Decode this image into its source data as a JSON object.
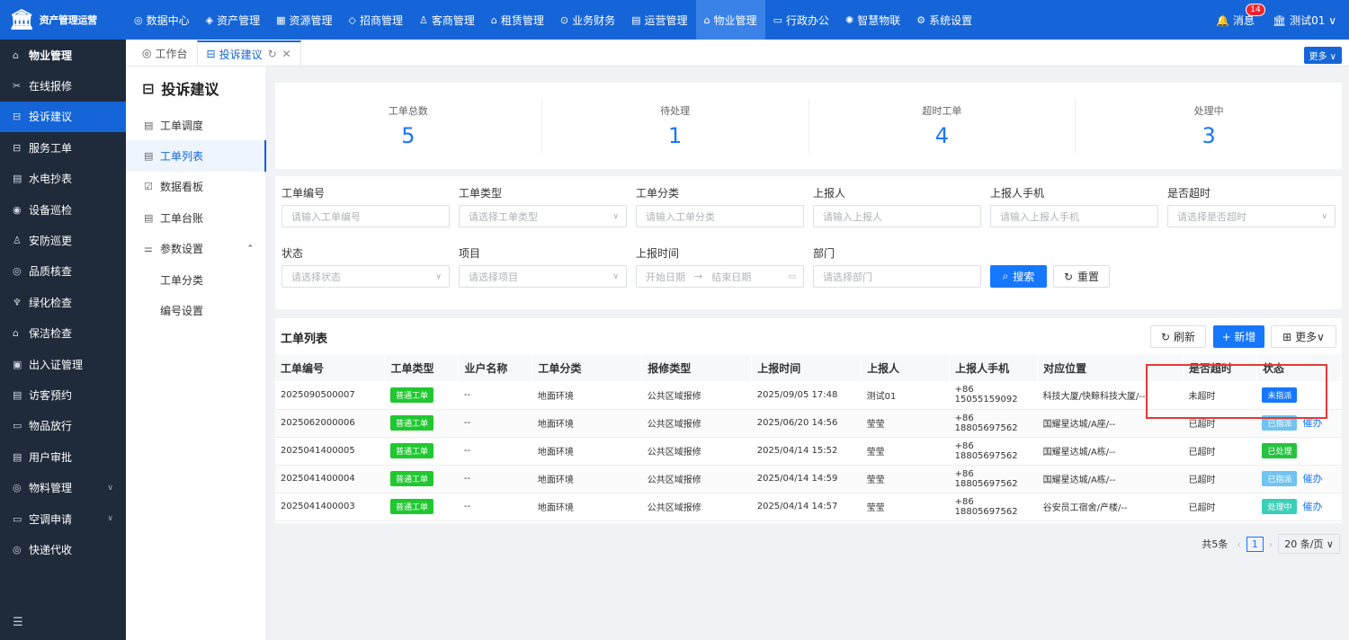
{
  "brand": "资产管理运营",
  "topnav": [
    {
      "label": "数据中心",
      "icon": "dashboard-icon"
    },
    {
      "label": "资产管理",
      "icon": "cube-icon"
    },
    {
      "label": "资源管理",
      "icon": "building-icon"
    },
    {
      "label": "招商管理",
      "icon": "tag-icon"
    },
    {
      "label": "客商管理",
      "icon": "users-icon"
    },
    {
      "label": "租赁管理",
      "icon": "house-icon"
    },
    {
      "label": "业务财务",
      "icon": "coin-icon"
    },
    {
      "label": "运营管理",
      "icon": "chart-icon"
    },
    {
      "label": "物业管理",
      "icon": "home-icon",
      "active": true
    },
    {
      "label": "行政办公",
      "icon": "monitor-icon"
    },
    {
      "label": "智慧物联",
      "icon": "iot-icon"
    },
    {
      "label": "系统设置",
      "icon": "gear-icon"
    }
  ],
  "topright": {
    "msg_label": "消息",
    "msg_count": "14",
    "user": "测试01"
  },
  "sidebar": [
    {
      "label": "物业管理",
      "bold": true
    },
    {
      "label": "在线报修"
    },
    {
      "label": "投诉建议",
      "active": true
    },
    {
      "label": "服务工单"
    },
    {
      "label": "水电抄表"
    },
    {
      "label": "设备巡检"
    },
    {
      "label": "安防巡更"
    },
    {
      "label": "品质核查"
    },
    {
      "label": "绿化检查"
    },
    {
      "label": "保洁检查"
    },
    {
      "label": "出入证管理"
    },
    {
      "label": "访客预约"
    },
    {
      "label": "物品放行"
    },
    {
      "label": "用户审批"
    },
    {
      "label": "物料管理",
      "arrow": true
    },
    {
      "label": "空调申请",
      "arrow": true
    },
    {
      "label": "快递代收"
    }
  ],
  "tabs": {
    "workbench": "工作台",
    "current": "投诉建议",
    "more": "更多"
  },
  "subside": {
    "title": "投诉建议",
    "items": [
      {
        "label": "工单调度"
      },
      {
        "label": "工单列表",
        "active": true
      },
      {
        "label": "数据看板"
      },
      {
        "label": "工单台账"
      },
      {
        "label": "参数设置",
        "arrow": true
      },
      {
        "label": "工单分类",
        "child": true
      },
      {
        "label": "编号设置",
        "child": true
      }
    ]
  },
  "stats": [
    {
      "label": "工单总数",
      "value": "5"
    },
    {
      "label": "待处理",
      "value": "1"
    },
    {
      "label": "超时工单",
      "value": "4"
    },
    {
      "label": "处理中",
      "value": "3"
    }
  ],
  "filter": {
    "f1": {
      "label": "工单编号",
      "placeholder": "请输入工单编号"
    },
    "f2": {
      "label": "工单类型",
      "placeholder": "请选择工单类型"
    },
    "f3": {
      "label": "工单分类",
      "placeholder": "请输入工单分类"
    },
    "f4": {
      "label": "上报人",
      "placeholder": "请输入上报人"
    },
    "f5": {
      "label": "上报人手机",
      "placeholder": "请输入上报人手机"
    },
    "f6": {
      "label": "是否超时",
      "placeholder": "请选择是否超时"
    },
    "f7": {
      "label": "状态",
      "placeholder": "请选择状态"
    },
    "f8": {
      "label": "项目",
      "placeholder": "请选择项目"
    },
    "f9": {
      "label": "上报时间",
      "start": "开始日期",
      "end": "结束日期"
    },
    "f10": {
      "label": "部门",
      "placeholder": "请选择部门"
    },
    "search": "搜索",
    "reset": "重置"
  },
  "list": {
    "title": "工单列表",
    "refresh": "刷新",
    "add": "+ 新增",
    "more": "更多",
    "headers": [
      "工单编号",
      "工单类型",
      "业户名称",
      "工单分类",
      "报修类型",
      "上报时间",
      "上报人",
      "上报人手机",
      "对应位置",
      "是否超时",
      "状态"
    ],
    "rows": [
      {
        "no": "2025090500007",
        "type": "普通工单",
        "owner": "--",
        "cat": "地面环境",
        "rtype": "公共区域报修",
        "time": "2025/09/05 17:48",
        "reporter": "测试01",
        "phone": "+86 15055159092",
        "loc": "科技大厦/快鲸科技大厦/--",
        "timeout": "未超时",
        "status": "未指派",
        "scolor": "blue",
        "action": ""
      },
      {
        "no": "2025062000006",
        "type": "普通工单",
        "owner": "--",
        "cat": "地面环境",
        "rtype": "公共区域报修",
        "time": "2025/06/20 14:56",
        "reporter": "莹莹",
        "phone": "+86 18805697562",
        "loc": "国耀星达城/A座/--",
        "timeout": "已超时",
        "status": "已指派",
        "scolor": "light",
        "action": "催办"
      },
      {
        "no": "2025041400005",
        "type": "普通工单",
        "owner": "--",
        "cat": "地面环境",
        "rtype": "公共区域报修",
        "time": "2025/04/14 15:52",
        "reporter": "莹莹",
        "phone": "+86 18805697562",
        "loc": "国耀星达城/A栋/--",
        "timeout": "已超时",
        "status": "已处理",
        "scolor": "okgreen",
        "action": ""
      },
      {
        "no": "2025041400004",
        "type": "普通工单",
        "owner": "--",
        "cat": "地面环境",
        "rtype": "公共区域报修",
        "time": "2025/04/14 14:59",
        "reporter": "莹莹",
        "phone": "+86 18805697562",
        "loc": "国耀星达城/A栋/--",
        "timeout": "已超时",
        "status": "已指派",
        "scolor": "light",
        "action": "催办"
      },
      {
        "no": "2025041400003",
        "type": "普通工单",
        "owner": "--",
        "cat": "地面环境",
        "rtype": "公共区域报修",
        "time": "2025/04/14 14:57",
        "reporter": "莹莹",
        "phone": "+86 18805697562",
        "loc": "谷安员工宿舍/产楼/--",
        "timeout": "已超时",
        "status": "处理中",
        "scolor": "teal",
        "action": "催办"
      }
    ]
  },
  "pager": {
    "total": "共5条",
    "page": "1",
    "size": "20 条/页"
  }
}
